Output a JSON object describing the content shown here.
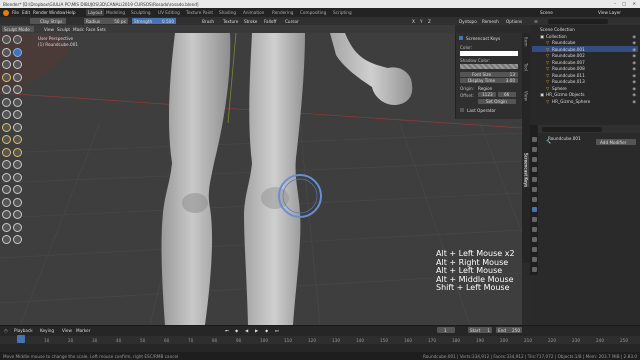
{
  "window": {
    "title": "Blender* [D:\\Dropbox\\GIULIA PC\\MIS DIBUJOS\\3D\\CANAL\\2019 CURSOS\\Rosado\\rosado.blend]"
  },
  "menu": [
    "File",
    "Edit",
    "Render",
    "Window",
    "Help"
  ],
  "workspace_tabs": [
    "Layout",
    "Modeling",
    "Sculpting",
    "UV Editing",
    "Texture Paint",
    "Shading",
    "Animation",
    "Rendering",
    "Compositing",
    "Scripting"
  ],
  "active_workspace": "Layout",
  "scene": {
    "scene_label": "Scene",
    "view_layer_label": "View Layer"
  },
  "tool_header": {
    "brush": "Clay Strips",
    "radius_label": "Radius",
    "radius_value": "50 px",
    "strength_label": "Strength",
    "strength_value": "0.500",
    "menus": [
      "Brush",
      "Texture",
      "Stroke",
      "Falloff",
      "Cursor"
    ],
    "x_label": "X",
    "y_label": "Y",
    "z_label": "Z",
    "dyntopo": "Dyntopo",
    "remesh": "Remesh",
    "options": "Options"
  },
  "mode_header": {
    "mode": "Sculpt Mode",
    "menus": [
      "View",
      "Sculpt",
      "Mask",
      "Face Sets"
    ]
  },
  "viewport": {
    "perspective": "User Perspective",
    "object": "(1) Roundcube.001"
  },
  "n_panel": {
    "section": "Screencast Keys",
    "color_label": "Color:",
    "shadow_label": "Shadow Color:",
    "font_size_label": "Font Size",
    "font_size_value": "13",
    "display_time_label": "Display Time",
    "display_time_value": "3.00",
    "origin_label": "Origin:",
    "origin_value": "Region",
    "offset_label": "Offset:",
    "offset_x": "1123",
    "offset_y": "66",
    "set_origin": "Set Origin",
    "last_operator": "Last Operator",
    "tabs": [
      "Item",
      "Tool",
      "View",
      "Screencast Keys"
    ],
    "colors": {
      "font": "#ffffff",
      "shadow": "#7a7a7a"
    }
  },
  "screencast_keys": [
    "Alt + Left Mouse x2",
    "Alt + Right Mouse",
    "Alt + Left Mouse",
    "Alt + Middle Mouse",
    "Shift + Left Mouse"
  ],
  "outliner": {
    "header": "Scene Collection",
    "items": [
      "Collection",
      "Roundcube",
      "Roundcube.001",
      "Roundcube.002",
      "Roundcube.007",
      "Roundcube.008",
      "Roundcube.011",
      "Roundcube.013",
      "Sphere",
      "HR_Gizmo Objects",
      "HR_Gizmo_Sphere"
    ],
    "selected": "Roundcube.001"
  },
  "properties": {
    "object_name": "Roundcube.001",
    "add_modifier": "Add Modifier"
  },
  "timeline": {
    "menus": [
      "Playback",
      "Keying",
      "View",
      "Marker"
    ],
    "current_frame": "1",
    "start_label": "Start",
    "start": "1",
    "end_label": "End",
    "end": "250",
    "ticks": [
      "0",
      "10",
      "20",
      "30",
      "40",
      "50",
      "60",
      "70",
      "80",
      "90",
      "100",
      "110",
      "120",
      "130",
      "140",
      "150",
      "160",
      "170",
      "180",
      "190",
      "200",
      "210",
      "220",
      "230",
      "240",
      "250"
    ]
  },
  "status": {
    "left": "Move Middle mouse to change the scale, Left mouse confirm, right ESC/RMB cancel",
    "right": "Roundcube.001 | Verts:334,912 | Faces:334,912 | Tris:717,072 | Objects:1/8 | Mem: 203.7 MiB | 2.83.0"
  }
}
